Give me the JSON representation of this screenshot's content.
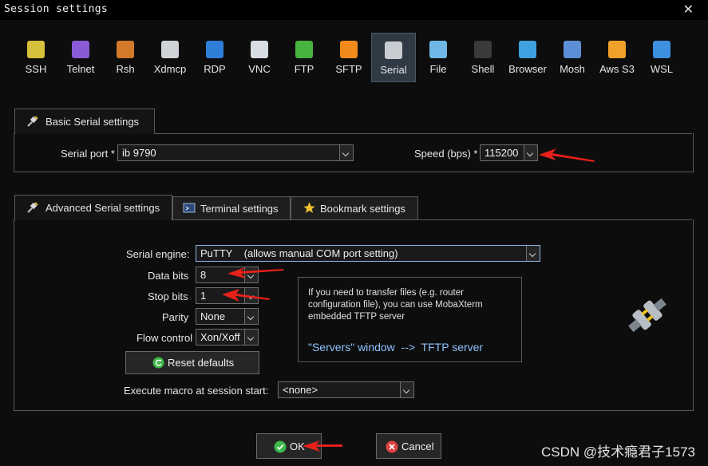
{
  "window": {
    "title": "Session settings",
    "close_glyph": "✕"
  },
  "protocols": [
    {
      "label": "SSH",
      "icon": "key-icon",
      "color": "#d7c03a"
    },
    {
      "label": "Telnet",
      "icon": "telnet-gem-icon",
      "color": "#8a5bd6"
    },
    {
      "label": "Rsh",
      "icon": "rsh-gears-icon",
      "color": "#d2792a"
    },
    {
      "label": "Xdmcp",
      "icon": "x-logo-icon",
      "color": "#cfd3d8"
    },
    {
      "label": "RDP",
      "icon": "windows-monitor-icon",
      "color": "#2f7fd8"
    },
    {
      "label": "VNC",
      "icon": "vnc-monitor-icon",
      "color": "#d8dde3"
    },
    {
      "label": "FTP",
      "icon": "green-globe-icon",
      "color": "#48b23f"
    },
    {
      "label": "SFTP",
      "icon": "orange-globe-icon",
      "color": "#f08a1c"
    },
    {
      "label": "Serial",
      "icon": "serial-plug-icon",
      "color": "#c9ccd0",
      "selected": true
    },
    {
      "label": "File",
      "icon": "file-monitor-icon",
      "color": "#6fb7e6"
    },
    {
      "label": "Shell",
      "icon": "shell-terminal-icon",
      "color": "#3a3a3a"
    },
    {
      "label": "Browser",
      "icon": "browser-globe-icon",
      "color": "#3fa2e0"
    },
    {
      "label": "Mosh",
      "icon": "satellite-dish-icon",
      "color": "#5d8fd6"
    },
    {
      "label": "Aws S3",
      "icon": "aws-cubes-icon",
      "color": "#f0a12a"
    },
    {
      "label": "WSL",
      "icon": "wsl-windows-icon",
      "color": "#3d8fe0"
    }
  ],
  "basic": {
    "tab_label": "Basic Serial settings",
    "serial_port_label": "Serial port *",
    "serial_port_value": "ib 9790",
    "speed_label": "Speed (bps) *",
    "speed_value": "115200"
  },
  "tabs": {
    "advanced": "Advanced Serial settings",
    "terminal": "Terminal settings",
    "bookmark": "Bookmark settings"
  },
  "advanced": {
    "engine_label": "Serial engine:",
    "engine_value": "PuTTY    (allows manual COM port setting)",
    "data_bits_label": "Data bits",
    "data_bits_value": "8",
    "stop_bits_label": "Stop bits",
    "stop_bits_value": "1",
    "parity_label": "Parity",
    "parity_value": "None",
    "flow_label": "Flow control",
    "flow_value": "Xon/Xoff",
    "reset_label": "Reset defaults",
    "macro_label": "Execute macro at session start:",
    "macro_value": "<none>",
    "info_text": "If you need to transfer files (e.g. router configuration file), you can use MobaXterm embedded TFTP server",
    "info_link": "\"Servers\" window  -->  TFTP server"
  },
  "footer": {
    "ok_label": "OK",
    "cancel_label": "Cancel"
  },
  "watermark": "CSDN @技术瘾君子1573"
}
